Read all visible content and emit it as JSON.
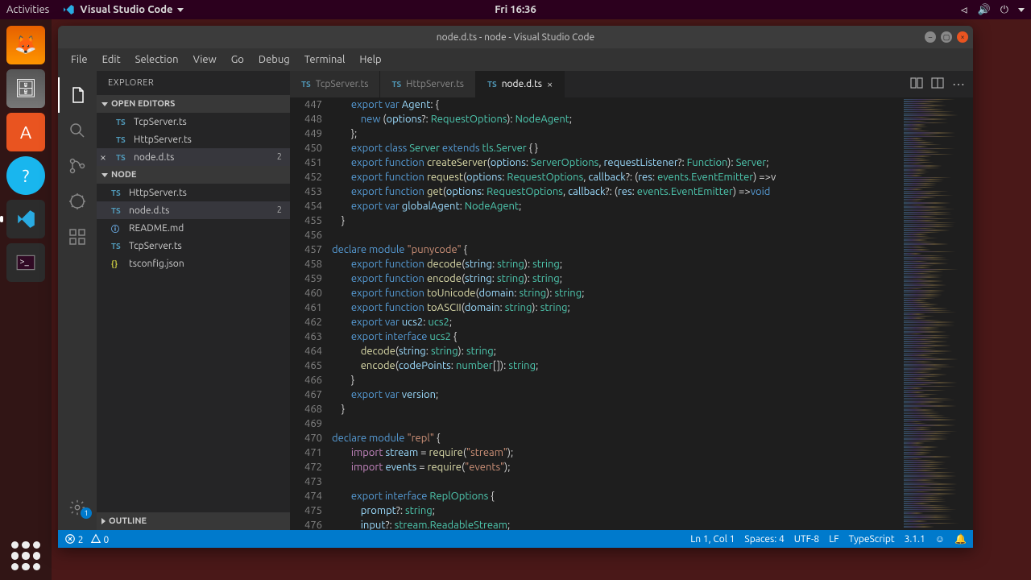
{
  "ubuntu": {
    "activities": "Activities",
    "appname": "Visual Studio Code",
    "clock": "Fri 16:36"
  },
  "window": {
    "title": "node.d.ts - node - Visual Studio Code"
  },
  "menu": [
    "File",
    "Edit",
    "Selection",
    "View",
    "Go",
    "Debug",
    "Terminal",
    "Help"
  ],
  "sidebar": {
    "title": "EXPLORER",
    "openEditors": "OPEN EDITORS",
    "editors": [
      {
        "name": "TcpServer.ts",
        "badge": ""
      },
      {
        "name": "HttpServer.ts",
        "badge": ""
      },
      {
        "name": "node.d.ts",
        "badge": "2",
        "active": true,
        "close": true
      }
    ],
    "project": "NODE",
    "files": [
      {
        "icon": "TS",
        "name": "HttpServer.ts"
      },
      {
        "icon": "TS",
        "name": "node.d.ts",
        "badge": "2",
        "active": true
      },
      {
        "icon": "ⓘ",
        "iconClass": "info",
        "name": "README.md"
      },
      {
        "icon": "TS",
        "name": "TcpServer.ts"
      },
      {
        "icon": "{}",
        "iconClass": "json",
        "name": "tsconfig.json"
      }
    ],
    "outline": "OUTLINE"
  },
  "tabs": [
    {
      "label": "TcpServer.ts",
      "active": false
    },
    {
      "label": "HttpServer.ts",
      "active": false
    },
    {
      "label": "node.d.ts",
      "active": true,
      "close": true
    }
  ],
  "lineStart": 447,
  "code": [
    [
      [
        "",
        "        "
      ],
      [
        "kw",
        "export"
      ],
      [
        "",
        " "
      ],
      [
        "kw",
        "var"
      ],
      [
        "",
        " "
      ],
      [
        "var",
        "Agent"
      ],
      [
        "pun",
        ": {"
      ]
    ],
    [
      [
        "",
        "            "
      ],
      [
        "kw",
        "new"
      ],
      [
        "",
        " "
      ],
      [
        "pun",
        "("
      ],
      [
        "var",
        "options"
      ],
      [
        "pun",
        "?: "
      ],
      [
        "cls",
        "RequestOptions"
      ],
      [
        "pun",
        "): "
      ],
      [
        "cls",
        "NodeAgent"
      ],
      [
        "pun",
        ";"
      ]
    ],
    [
      [
        "",
        "        "
      ],
      [
        "pun",
        "};"
      ]
    ],
    [
      [
        "",
        "        "
      ],
      [
        "kw",
        "export"
      ],
      [
        "",
        " "
      ],
      [
        "kw",
        "class"
      ],
      [
        "",
        " "
      ],
      [
        "cls",
        "Server"
      ],
      [
        "",
        " "
      ],
      [
        "kw",
        "extends"
      ],
      [
        "",
        " "
      ],
      [
        "cls",
        "tls.Server"
      ],
      [
        "",
        " "
      ],
      [
        "pun",
        "{ }"
      ]
    ],
    [
      [
        "",
        "        "
      ],
      [
        "kw",
        "export"
      ],
      [
        "",
        " "
      ],
      [
        "kw",
        "function"
      ],
      [
        "",
        " "
      ],
      [
        "fn",
        "createServer"
      ],
      [
        "pun",
        "("
      ],
      [
        "var",
        "options"
      ],
      [
        "pun",
        ": "
      ],
      [
        "cls",
        "ServerOptions"
      ],
      [
        "pun",
        ", "
      ],
      [
        "var",
        "requestListener"
      ],
      [
        "pun",
        "?: "
      ],
      [
        "cls",
        "Function"
      ],
      [
        "pun",
        "): "
      ],
      [
        "cls",
        "Server"
      ],
      [
        "pun",
        ";"
      ]
    ],
    [
      [
        "",
        "        "
      ],
      [
        "kw",
        "export"
      ],
      [
        "",
        " "
      ],
      [
        "kw",
        "function"
      ],
      [
        "",
        " "
      ],
      [
        "fn",
        "request"
      ],
      [
        "pun",
        "("
      ],
      [
        "var",
        "options"
      ],
      [
        "pun",
        ": "
      ],
      [
        "cls",
        "RequestOptions"
      ],
      [
        "pun",
        ", "
      ],
      [
        "var",
        "callback"
      ],
      [
        "pun",
        "?: ("
      ],
      [
        "var",
        "res"
      ],
      [
        "pun",
        ": "
      ],
      [
        "cls",
        "events.EventEmitter"
      ],
      [
        "pun",
        ") =>v"
      ]
    ],
    [
      [
        "",
        "        "
      ],
      [
        "kw",
        "export"
      ],
      [
        "",
        " "
      ],
      [
        "kw",
        "function"
      ],
      [
        "",
        " "
      ],
      [
        "fn",
        "get"
      ],
      [
        "pun",
        "("
      ],
      [
        "var",
        "options"
      ],
      [
        "pun",
        ": "
      ],
      [
        "cls",
        "RequestOptions"
      ],
      [
        "pun",
        ", "
      ],
      [
        "var",
        "callback"
      ],
      [
        "pun",
        "?: ("
      ],
      [
        "var",
        "res"
      ],
      [
        "pun",
        ": "
      ],
      [
        "cls",
        "events.EventEmitter"
      ],
      [
        "pun",
        ") =>"
      ],
      [
        "kw",
        "void"
      ]
    ],
    [
      [
        "",
        "        "
      ],
      [
        "kw",
        "export"
      ],
      [
        "",
        " "
      ],
      [
        "kw",
        "var"
      ],
      [
        "",
        " "
      ],
      [
        "var",
        "globalAgent"
      ],
      [
        "pun",
        ": "
      ],
      [
        "cls",
        "NodeAgent"
      ],
      [
        "pun",
        ";"
      ]
    ],
    [
      [
        "",
        "    "
      ],
      [
        "pun",
        "}"
      ]
    ],
    [
      [
        "",
        ""
      ]
    ],
    [
      [
        "kw",
        "declare"
      ],
      [
        "",
        " "
      ],
      [
        "kw",
        "module"
      ],
      [
        "",
        " "
      ],
      [
        "str",
        "\"punycode\""
      ],
      [
        "",
        " "
      ],
      [
        "pun",
        "{"
      ]
    ],
    [
      [
        "",
        "        "
      ],
      [
        "kw",
        "export"
      ],
      [
        "",
        " "
      ],
      [
        "kw",
        "function"
      ],
      [
        "",
        " "
      ],
      [
        "fn",
        "decode"
      ],
      [
        "pun",
        "("
      ],
      [
        "var",
        "string"
      ],
      [
        "pun",
        ": "
      ],
      [
        "cls",
        "string"
      ],
      [
        "pun",
        "): "
      ],
      [
        "cls",
        "string"
      ],
      [
        "pun",
        ";"
      ]
    ],
    [
      [
        "",
        "        "
      ],
      [
        "kw",
        "export"
      ],
      [
        "",
        " "
      ],
      [
        "kw",
        "function"
      ],
      [
        "",
        " "
      ],
      [
        "fn",
        "encode"
      ],
      [
        "pun",
        "("
      ],
      [
        "var",
        "string"
      ],
      [
        "pun",
        ": "
      ],
      [
        "cls",
        "string"
      ],
      [
        "pun",
        "): "
      ],
      [
        "cls",
        "string"
      ],
      [
        "pun",
        ";"
      ]
    ],
    [
      [
        "",
        "        "
      ],
      [
        "kw",
        "export"
      ],
      [
        "",
        " "
      ],
      [
        "kw",
        "function"
      ],
      [
        "",
        " "
      ],
      [
        "fn",
        "toUnicode"
      ],
      [
        "pun",
        "("
      ],
      [
        "var",
        "domain"
      ],
      [
        "pun",
        ": "
      ],
      [
        "cls",
        "string"
      ],
      [
        "pun",
        "): "
      ],
      [
        "cls",
        "string"
      ],
      [
        "pun",
        ";"
      ]
    ],
    [
      [
        "",
        "        "
      ],
      [
        "kw",
        "export"
      ],
      [
        "",
        " "
      ],
      [
        "kw",
        "function"
      ],
      [
        "",
        " "
      ],
      [
        "fn",
        "toASCII"
      ],
      [
        "pun",
        "("
      ],
      [
        "var",
        "domain"
      ],
      [
        "pun",
        ": "
      ],
      [
        "cls",
        "string"
      ],
      [
        "pun",
        "): "
      ],
      [
        "cls",
        "string"
      ],
      [
        "pun",
        ";"
      ]
    ],
    [
      [
        "",
        "        "
      ],
      [
        "kw",
        "export"
      ],
      [
        "",
        " "
      ],
      [
        "kw",
        "var"
      ],
      [
        "",
        " "
      ],
      [
        "var",
        "ucs2"
      ],
      [
        "pun",
        ": "
      ],
      [
        "cls",
        "ucs2"
      ],
      [
        "pun",
        ";"
      ]
    ],
    [
      [
        "",
        "        "
      ],
      [
        "kw",
        "export"
      ],
      [
        "",
        " "
      ],
      [
        "kw",
        "interface"
      ],
      [
        "",
        " "
      ],
      [
        "cls",
        "ucs2"
      ],
      [
        "",
        " "
      ],
      [
        "pun",
        "{"
      ]
    ],
    [
      [
        "",
        "            "
      ],
      [
        "fn",
        "decode"
      ],
      [
        "pun",
        "("
      ],
      [
        "var",
        "string"
      ],
      [
        "pun",
        ": "
      ],
      [
        "cls",
        "string"
      ],
      [
        "pun",
        "): "
      ],
      [
        "cls",
        "string"
      ],
      [
        "pun",
        ";"
      ]
    ],
    [
      [
        "",
        "            "
      ],
      [
        "fn",
        "encode"
      ],
      [
        "pun",
        "("
      ],
      [
        "var",
        "codePoints"
      ],
      [
        "pun",
        ": "
      ],
      [
        "cls",
        "number"
      ],
      [
        "pun",
        "[]): "
      ],
      [
        "cls",
        "string"
      ],
      [
        "pun",
        ";"
      ]
    ],
    [
      [
        "",
        "        "
      ],
      [
        "pun",
        "}"
      ]
    ],
    [
      [
        "",
        "        "
      ],
      [
        "kw",
        "export"
      ],
      [
        "",
        " "
      ],
      [
        "kw",
        "var"
      ],
      [
        "",
        " "
      ],
      [
        "var",
        "version"
      ],
      [
        "pun",
        ";"
      ]
    ],
    [
      [
        "",
        "    "
      ],
      [
        "pun",
        "}"
      ]
    ],
    [
      [
        "",
        ""
      ]
    ],
    [
      [
        "kw",
        "declare"
      ],
      [
        "",
        " "
      ],
      [
        "kw",
        "module"
      ],
      [
        "",
        " "
      ],
      [
        "str",
        "\"repl\""
      ],
      [
        "",
        " "
      ],
      [
        "pun",
        "{"
      ]
    ],
    [
      [
        "",
        "        "
      ],
      [
        "kw2",
        "import"
      ],
      [
        "",
        " "
      ],
      [
        "var",
        "stream"
      ],
      [
        "",
        " = "
      ],
      [
        "fn",
        "require"
      ],
      [
        "pun",
        "("
      ],
      [
        "str",
        "\"stream\""
      ],
      [
        "pun",
        ");"
      ]
    ],
    [
      [
        "",
        "        "
      ],
      [
        "kw2",
        "import"
      ],
      [
        "",
        " "
      ],
      [
        "var",
        "events"
      ],
      [
        "",
        " = "
      ],
      [
        "fn",
        "require"
      ],
      [
        "pun",
        "("
      ],
      [
        "str",
        "\"events\""
      ],
      [
        "pun",
        ");"
      ]
    ],
    [
      [
        "",
        ""
      ]
    ],
    [
      [
        "",
        "        "
      ],
      [
        "kw",
        "export"
      ],
      [
        "",
        " "
      ],
      [
        "kw",
        "interface"
      ],
      [
        "",
        " "
      ],
      [
        "cls",
        "ReplOptions"
      ],
      [
        "",
        " "
      ],
      [
        "pun",
        "{"
      ]
    ],
    [
      [
        "",
        "            "
      ],
      [
        "var",
        "prompt"
      ],
      [
        "pun",
        "?: "
      ],
      [
        "cls",
        "string"
      ],
      [
        "pun",
        ";"
      ]
    ],
    [
      [
        "",
        "            "
      ],
      [
        "var",
        "input"
      ],
      [
        "pun",
        "?: "
      ],
      [
        "cls",
        "stream.ReadableStream"
      ],
      [
        "pun",
        ";"
      ]
    ]
  ],
  "status": {
    "errors": "2",
    "warnings": "0",
    "cursor": "Ln 1, Col 1",
    "spaces": "Spaces: 4",
    "encoding": "UTF-8",
    "eol": "LF",
    "lang": "TypeScript",
    "version": "3.1.1"
  },
  "settingsBadge": "1"
}
